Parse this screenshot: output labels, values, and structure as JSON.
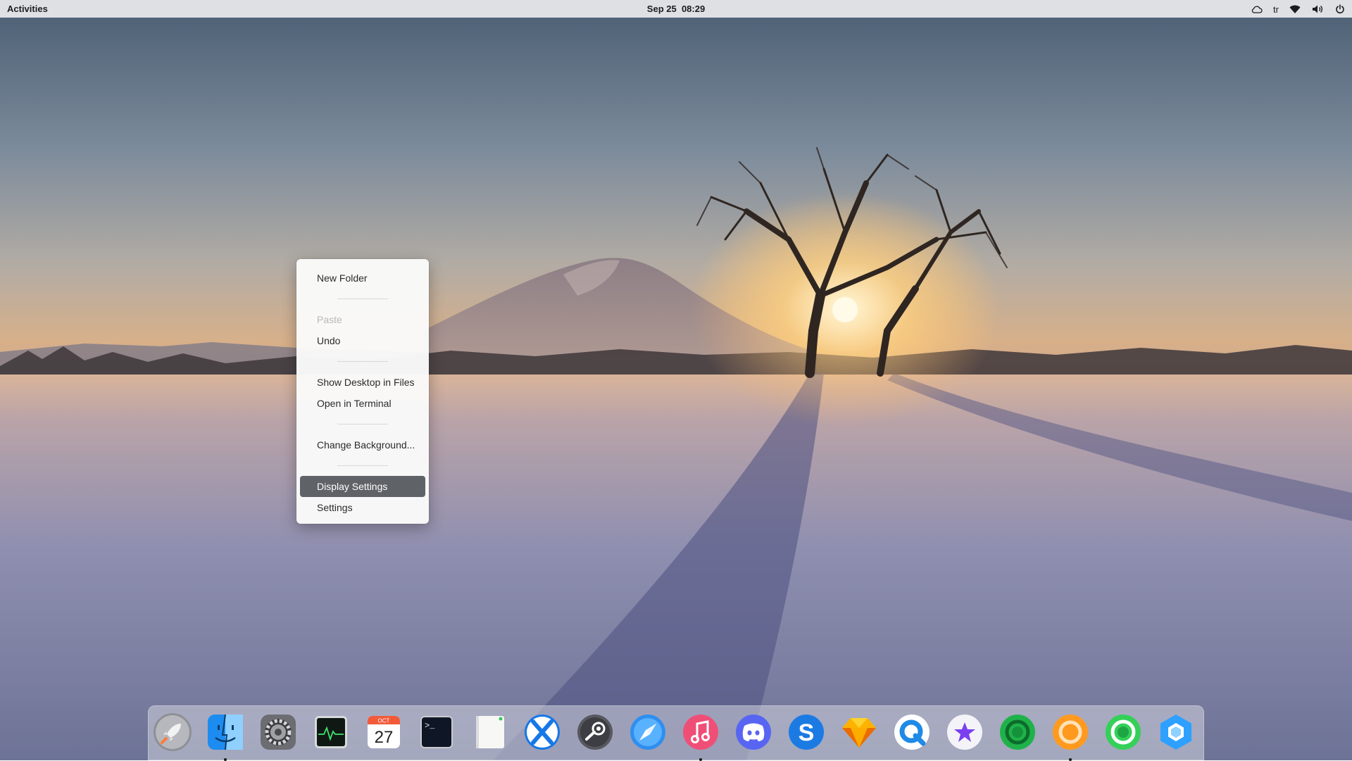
{
  "topbar": {
    "activities_label": "Activities",
    "date": "Sep 25",
    "time": "08:29",
    "tray": {
      "cloud_icon": "cloud-icon",
      "language": "tr",
      "wifi_icon": "wifi-icon",
      "volume_icon": "volume-icon",
      "power_icon": "power-icon"
    }
  },
  "context_menu": {
    "items": [
      {
        "label": "New Folder",
        "enabled": true
      },
      {
        "label": "Paste",
        "enabled": false
      },
      {
        "label": "Undo",
        "enabled": true
      },
      {
        "label": "Show Desktop in Files",
        "enabled": true
      },
      {
        "label": "Open in Terminal",
        "enabled": true
      },
      {
        "label": "Change Background...",
        "enabled": true
      },
      {
        "label": "Display Settings",
        "enabled": true,
        "highlighted": true
      },
      {
        "label": "Settings",
        "enabled": true
      }
    ]
  },
  "dock": {
    "apps": [
      {
        "icon": "launchpad-rocket-icon",
        "running": false
      },
      {
        "icon": "finder-files-icon",
        "running": true
      },
      {
        "icon": "system-settings-gear-icon",
        "running": false
      },
      {
        "icon": "activity-monitor-icon",
        "running": false
      },
      {
        "icon": "calendar-icon",
        "running": false
      },
      {
        "icon": "terminal-icon",
        "running": false
      },
      {
        "icon": "text-editor-icon",
        "running": false
      },
      {
        "icon": "x-app-icon",
        "running": false
      },
      {
        "icon": "steam-icon",
        "running": false
      },
      {
        "icon": "safari-compass-icon",
        "running": false
      },
      {
        "icon": "music-icon",
        "running": true
      },
      {
        "icon": "discord-icon",
        "running": false
      },
      {
        "icon": "skype-icon",
        "running": false
      },
      {
        "icon": "sketch-diamond-icon",
        "running": false
      },
      {
        "icon": "q-search-icon",
        "running": false
      },
      {
        "icon": "star-app-icon",
        "running": false
      },
      {
        "icon": "green-chat-icon",
        "running": false
      },
      {
        "icon": "orange-ring-icon",
        "running": true
      },
      {
        "icon": "green-ring-icon",
        "running": false
      },
      {
        "icon": "blue-hexagon-icon",
        "running": false
      }
    ],
    "calendar": {
      "month": "OCT",
      "day": "27"
    },
    "terminal_prompt": ">_"
  },
  "colors": {
    "menu_highlight": "#5f6267",
    "topbar_bg": "#ececee"
  }
}
